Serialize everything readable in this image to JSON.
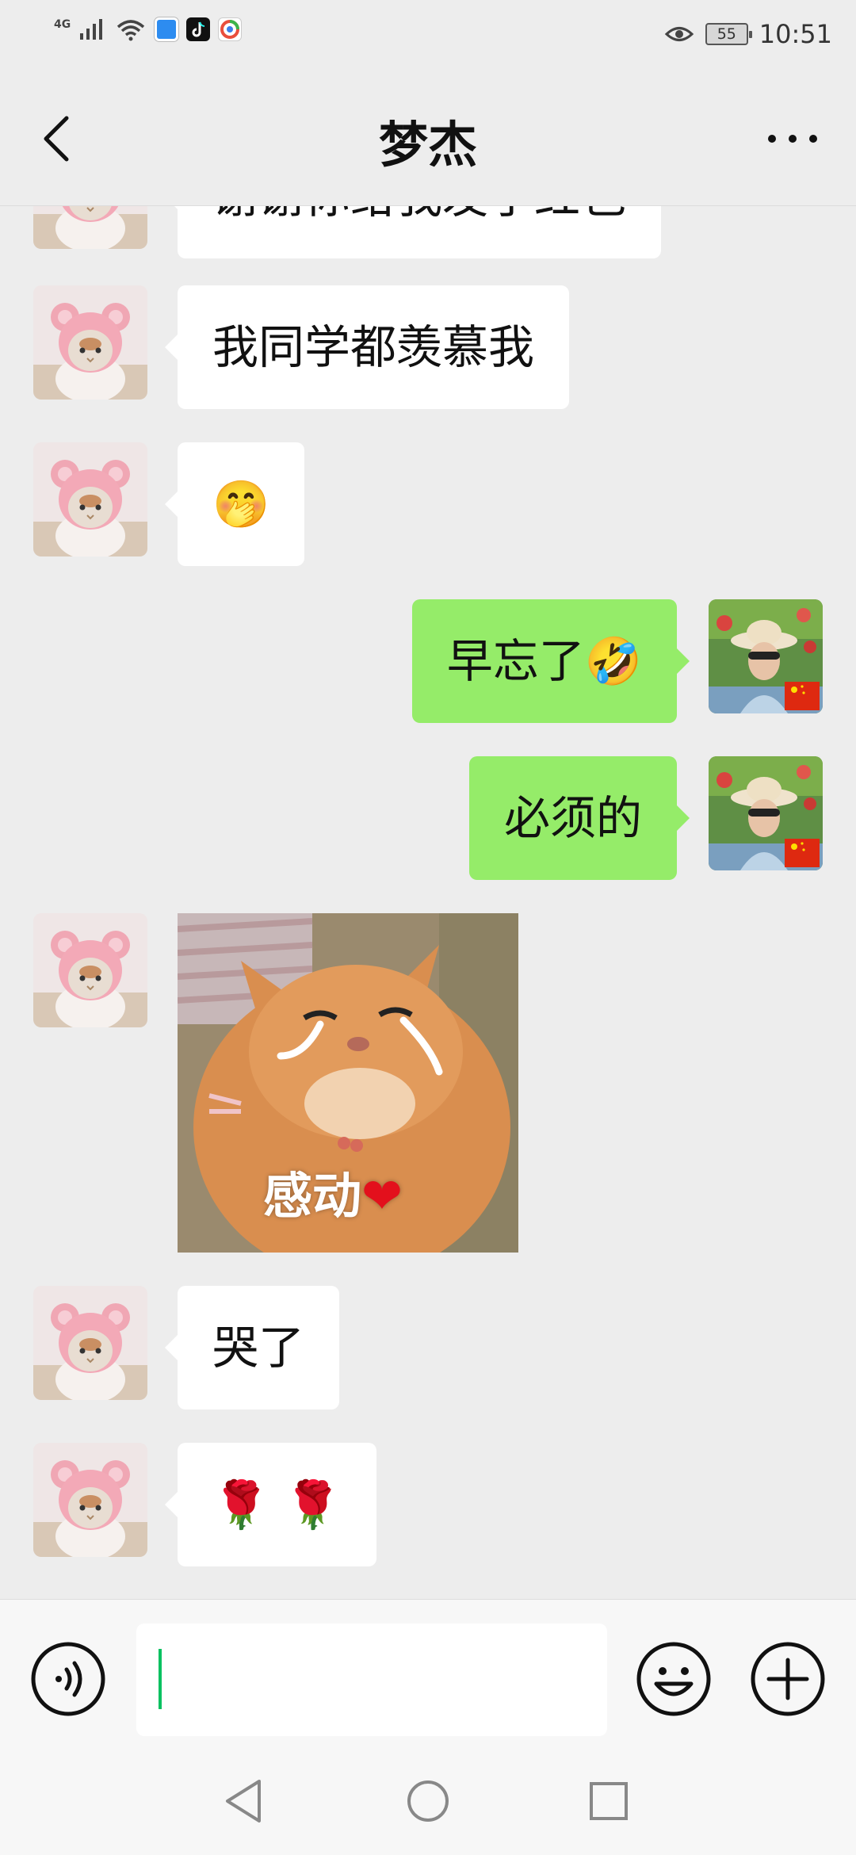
{
  "status_bar": {
    "network": "4G",
    "battery": "55",
    "time": "10:51"
  },
  "header": {
    "title": "梦杰"
  },
  "messages": [
    {
      "side": "in",
      "text": "谢谢你给我发了红包"
    },
    {
      "side": "in",
      "text": "我同学都羡慕我"
    },
    {
      "side": "in",
      "emoji": "🤭"
    },
    {
      "side": "out",
      "text": "早忘了",
      "emoji": "🤣"
    },
    {
      "side": "out",
      "text": "必须的"
    },
    {
      "side": "in",
      "sticker_caption": "感动",
      "sticker_heart": "❤"
    },
    {
      "side": "in",
      "text": "哭了"
    },
    {
      "side": "in",
      "emoji": "🌹 🌹"
    }
  ],
  "input": {
    "value": "",
    "placeholder": ""
  },
  "colors": {
    "background": "#ededed",
    "incoming_bubble": "#ffffff",
    "outgoing_bubble": "#95ec69",
    "caret": "#07c160"
  },
  "icons": {
    "back": "chevron-left-icon",
    "more": "more-dots-icon",
    "voice": "voice-icon",
    "emoji": "smiley-icon",
    "plus": "plus-icon",
    "nav_back": "triangle-back-icon",
    "nav_home": "circle-home-icon",
    "nav_recents": "square-recents-icon"
  }
}
